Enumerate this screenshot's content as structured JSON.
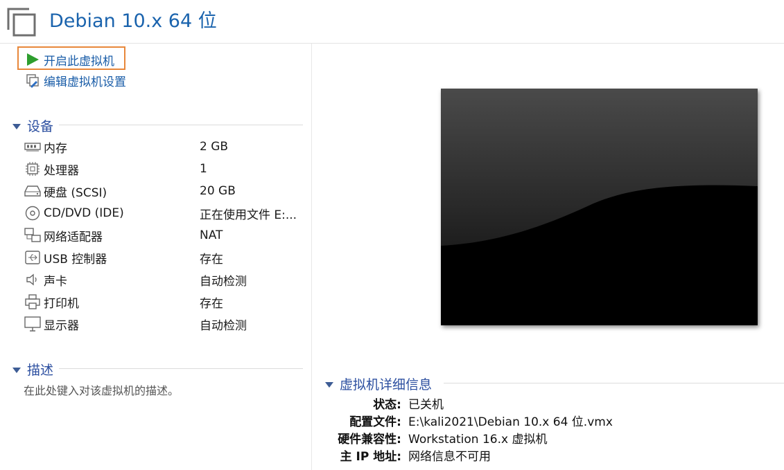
{
  "header": {
    "title": "Debian 10.x 64 位"
  },
  "actions": {
    "start_label": "开启此虚拟机",
    "edit_label": "编辑虚拟机设置"
  },
  "devices": {
    "title": "设备",
    "items": [
      {
        "name": "内存",
        "value": "2 GB",
        "icon": "memory-icon"
      },
      {
        "name": "处理器",
        "value": "1",
        "icon": "processor-icon"
      },
      {
        "name": "硬盘 (SCSI)",
        "value": "20 GB",
        "icon": "hard-disk-icon"
      },
      {
        "name": "CD/DVD (IDE)",
        "value": "正在使用文件 E:...",
        "icon": "cd-dvd-icon"
      },
      {
        "name": "网络适配器",
        "value": "NAT",
        "icon": "network-adapter-icon"
      },
      {
        "name": "USB 控制器",
        "value": "存在",
        "icon": "usb-controller-icon"
      },
      {
        "name": "声卡",
        "value": "自动检测",
        "icon": "sound-card-icon"
      },
      {
        "name": "打印机",
        "value": "存在",
        "icon": "printer-icon"
      },
      {
        "name": "显示器",
        "value": "自动检测",
        "icon": "display-icon"
      }
    ]
  },
  "description": {
    "title": "描述",
    "placeholder": "在此处键入对该虚拟机的描述。"
  },
  "details": {
    "title": "虚拟机详细信息",
    "rows": [
      {
        "label": "状态:",
        "value": "已关机"
      },
      {
        "label": "配置文件:",
        "value": "E:\\kali2021\\Debian 10.x 64 位.vmx"
      },
      {
        "label": "硬件兼容性:",
        "value": "Workstation 16.x 虚拟机"
      },
      {
        "label": "主 IP 地址:",
        "value": "网络信息不可用"
      }
    ]
  },
  "colors": {
    "accent": "#1a63ad",
    "highlight_border": "#e8873a",
    "play_green": "#2e9e2e"
  }
}
